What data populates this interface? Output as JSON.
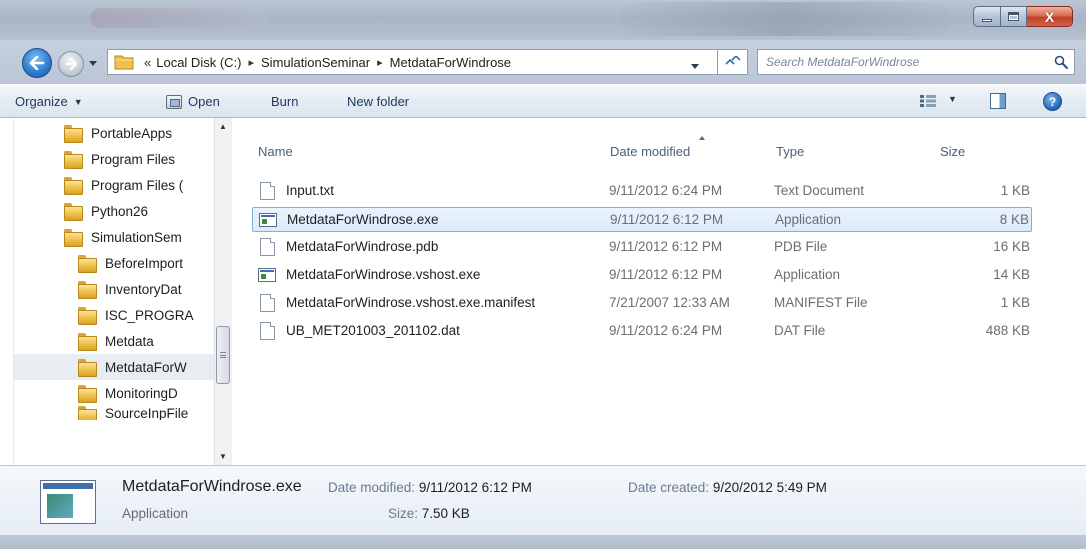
{
  "window": {
    "controls": {
      "minimize_icon": "minimize-icon",
      "maximize_icon": "maximize-icon",
      "close_icon": "close-icon",
      "close_glyph": "X"
    }
  },
  "address": {
    "overflow_marker": "«",
    "crumbs": [
      "Local Disk (C:)",
      "SimulationSeminar",
      "MetdataForWindrose"
    ],
    "separator": "▸",
    "refresh_glyph": "⁺⁺"
  },
  "search": {
    "placeholder": "Search MetdataForWindrose"
  },
  "toolbar": {
    "organize": "Organize",
    "open": "Open",
    "burn": "Burn",
    "new_folder": "New folder",
    "help_glyph": "?"
  },
  "nav_pane": {
    "items": [
      {
        "label": "PortableApps",
        "indent": 0
      },
      {
        "label": "Program Files",
        "indent": 0
      },
      {
        "label": "Program Files (",
        "indent": 0
      },
      {
        "label": "Python26",
        "indent": 0
      },
      {
        "label": "SimulationSem",
        "indent": 0
      },
      {
        "label": "BeforeImport",
        "indent": 1
      },
      {
        "label": "InventoryDat",
        "indent": 1
      },
      {
        "label": "ISC_PROGRA",
        "indent": 1
      },
      {
        "label": "Metdata",
        "indent": 1
      },
      {
        "label": "MetdataForW",
        "indent": 1,
        "selected": true
      },
      {
        "label": "MonitoringD",
        "indent": 1
      },
      {
        "label": "SourceInpFile",
        "indent": 1
      }
    ]
  },
  "file_list": {
    "columns": {
      "name": "Name",
      "date": "Date modified",
      "type": "Type",
      "size": "Size"
    },
    "rows": [
      {
        "name": "Input.txt",
        "date": "9/11/2012 6:24 PM",
        "type": "Text Document",
        "size": "1 KB",
        "icon": "text-file-icon"
      },
      {
        "name": "MetdataForWindrose.exe",
        "date": "9/11/2012 6:12 PM",
        "type": "Application",
        "size": "8 KB",
        "icon": "application-icon",
        "selected": true
      },
      {
        "name": "MetdataForWindrose.pdb",
        "date": "9/11/2012 6:12 PM",
        "type": "PDB File",
        "size": "16 KB",
        "icon": "file-icon"
      },
      {
        "name": "MetdataForWindrose.vshost.exe",
        "date": "9/11/2012 6:12 PM",
        "type": "Application",
        "size": "14 KB",
        "icon": "application-icon"
      },
      {
        "name": "MetdataForWindrose.vshost.exe.manifest",
        "date": "7/21/2007 12:33 AM",
        "type": "MANIFEST File",
        "size": "1 KB",
        "icon": "file-icon"
      },
      {
        "name": "UB_MET201003_201102.dat",
        "date": "9/11/2012 6:24 PM",
        "type": "DAT File",
        "size": "488 KB",
        "icon": "file-icon"
      }
    ]
  },
  "details": {
    "name": "MetdataForWindrose.exe",
    "type": "Application",
    "modified_label": "Date modified:",
    "modified_value": "9/11/2012 6:12 PM",
    "size_label": "Size:",
    "size_value": "7.50 KB",
    "created_label": "Date created:",
    "created_value": "9/20/2012 5:49 PM"
  },
  "colors": {
    "selection_fill": "#dcebfc",
    "selection_border": "#84acdd",
    "toolbar_text": "#1e395b",
    "close_red": "#c1412a"
  }
}
